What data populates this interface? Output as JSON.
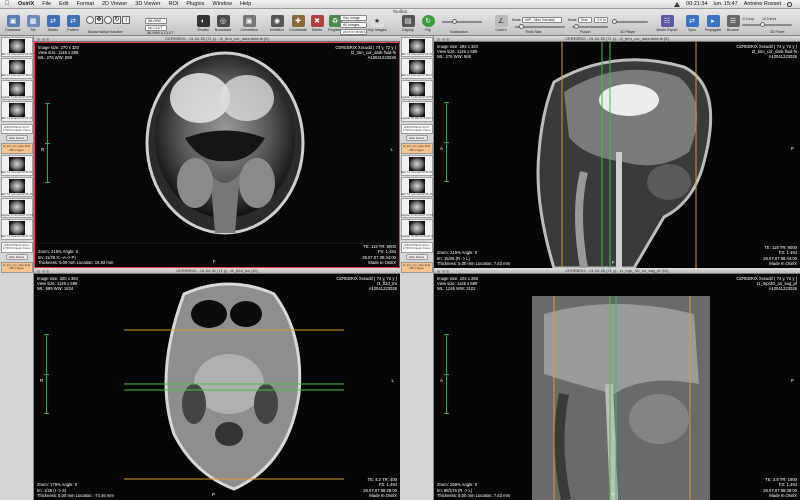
{
  "menubar": {
    "app": "OsiriX",
    "items": [
      "File",
      "Edit",
      "Format",
      "2D Viewer",
      "3D Viewer",
      "ROI",
      "Plugins",
      "Window",
      "Help"
    ],
    "clock": "00:21:34",
    "date": "lun. 15:47",
    "user": "Antoine Rosset"
  },
  "toolbar": {
    "title": "Toolbar",
    "left_buttons": [
      "Database",
      "Tile",
      "Series",
      "Patient"
    ],
    "mouse_label": "Mouse button function",
    "wlww_label": "WL/WW & CLUT",
    "wlww_value": "WL/WW",
    "clut_value": "No CLUT",
    "right_buttons": [
      "Shutter",
      "Broadcast",
      "Orientation",
      "Inhibition",
      "Coordinate",
      "Delete",
      "Register",
      "Key Images"
    ],
    "key_image_field": "Key Image",
    "all_images_field": "All Images",
    "date_field": "26.07.07 08:06:41",
    "display_label": "Display",
    "flip_label": "Flip",
    "subtraction_label": "Subtraction",
    "cobbs_label": "Cobb's",
    "thick_slab_label": "Thick Slab",
    "fusion_label": "Fusion",
    "player_label": "4D Player",
    "movie_label": "Movie Export",
    "sync_label": "Sync",
    "propagate_label": "Propagate",
    "browse_label": "Browse",
    "panel3d_label": "3D Panel",
    "mode_label": "Mode",
    "mode_value": "MIP - Max Intensity",
    "slab_value": "Slab",
    "percent_value": "0.0 %",
    "locked_label": "Loop",
    "fps_value": "10.0 im/s",
    "thickslab_btn": "POSSIX"
  },
  "sidebar": {
    "cells": [
      {
        "text": "REF T2 Coronal 02.06.07 17:06:04"
      },
      {
        "text": "REF T2 Coronal 02.06.07 17:06:04 146 Images"
      },
      {
        "text": "Sagittal T1 01.04.07 07:51:00"
      },
      {
        "text": "REF T2 Axial 02.06.07 17:06:04"
      },
      {
        "text": "Sagittal T2 MR 01.04.07 07:51:00"
      }
    ],
    "series_text": "ANONYME 01.04.07 17:06:04 Neuro Crane",
    "hide_series": "Hide Series",
    "active_text": "t2_tirm_cor_dark-fluid 256 Images"
  },
  "viewers": [
    {
      "title": "CEREBRIX - 01.04.35 (71 y) - t2_tirm_cor_dark-fluid-fs (5)",
      "tl": [
        "Image size: 270 x 320",
        "View size: 1145 x 689",
        "WL: 276 WW: 588"
      ],
      "tr": [
        "CEREBRIX Xxxudd ( 74 y, 72 y )",
        "t2_tirm_cor_dark-fluid-fs",
        "A10041223026"
      ],
      "bl": [
        "Zoom: 215% Angle: 0",
        "Im: 11/28   X: -A -> P)",
        "Thickness: 5.00 mm Location: 16.92 mm"
      ],
      "br": [
        "TE: 119 TR: 9000",
        "FS: 1.494",
        "26.07.07 08:44:00",
        "Made In OsiriX"
      ],
      "left_orient": "R",
      "right_orient": "L",
      "bottom_orient": "F"
    },
    {
      "title": "CEREBRIX - 01.04.35 (71 y) - t2_tirm_cor_dark-fluid-fs (5)",
      "tl": [
        "Image size: 284 x 320",
        "View size: 1145 x 689",
        "WL: 276 WW: 588"
      ],
      "tr": [
        "CEREBRIX Xxxudd ( 74 y, 72 y )",
        "t2_tirm_cor_dark-fluid-fs",
        "A10041223026"
      ],
      "bl": [
        "Zoom: 215% Angle: 0",
        "Im: 15/28   (R -> L)",
        "Thickness: 5.00 mm Location: 7.63 mm"
      ],
      "br": [
        "TE: 119 TR: 9000",
        "FS: 1.494",
        "26.07.07 08:44:00",
        "Made In OsiriX"
      ],
      "left_orient": "A",
      "right_orient": "P",
      "bottom_orient": "F"
    },
    {
      "title": "CEREBRIX - 01.04.35 (71 y) - t1_fl2d_tra (10)",
      "tl": [
        "Image size: 320 x 384",
        "View size: 1145 x 689",
        "WL: 899 WW: 1824"
      ],
      "tr": [
        "CEREBRIX Xxxudd ( 74 y, 72 y )",
        "t1_fl2d_tra",
        "A10041223026"
      ],
      "bl": [
        "Zoom: 179% Angle: 0",
        "Im: 1/29   (I -> S)",
        "Thickness: 5.00 mm Location: -74.46 mm"
      ],
      "br": [
        "TE: 4.2 TR: 400",
        "FS: 1.494",
        "26.07.07 08:28:00",
        "Made In OsiriX"
      ],
      "left_orient": "R",
      "right_orient": "L",
      "bottom_orient": "P"
    },
    {
      "title": "CEREBRIX - 01.04.35 (71 y) - t1_mpr_3D_ns_sag_pf (10)",
      "tl": [
        "Image size: 224 x 256",
        "View size: 1145 x 689",
        "WL: 1246 WW: 3102"
      ],
      "tr": [
        "CEREBRIX Xxxudd ( 74 y, 72 y )",
        "t1_mpr3D_ns_sag_pf",
        "A10041223026"
      ],
      "bl": [
        "Zoom: 269% Angle: 0",
        "Im: 98/176   (R -> L)",
        "Thickness: 5.00 mm Location: 7.63 mm"
      ],
      "br": [
        "TE: 3.9 TR: 1900",
        "FS: 1.494",
        "26.07.07 08:39:00",
        "Made In OsiriX"
      ],
      "left_orient": "A",
      "right_orient": "P",
      "bottom_orient": "F"
    }
  ]
}
